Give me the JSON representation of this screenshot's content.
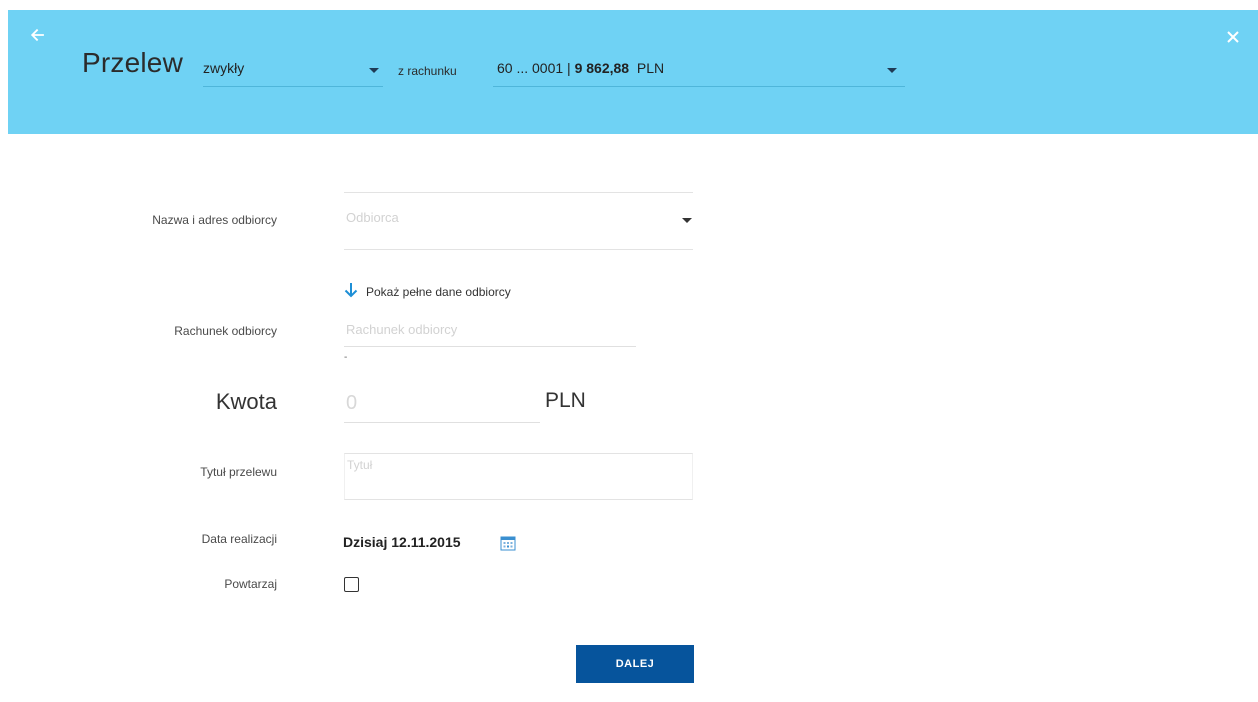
{
  "header": {
    "title": "Przelew",
    "transfer_type": "zwykły",
    "from_account_label": "z rachunku",
    "account_number": "60 ... 0001 | ",
    "balance": "9 862,88",
    "currency": "PLN",
    "back_icon": "arrow-left-icon",
    "close_icon": "close-icon",
    "background_color": "#6fd2f4"
  },
  "form": {
    "recipient_label": "Nazwa i adres odbiorcy",
    "recipient_placeholder": "Odbiorca",
    "show_more_label": "Pokaż pełne dane odbiorcy",
    "account_label": "Rachunek odbiorcy",
    "account_placeholder": "Rachunek odbiorcy",
    "account_hint": "-",
    "amount_label": "Kwota",
    "amount_placeholder": "0",
    "amount_currency": "PLN",
    "title_label": "Tytuł przelewu",
    "title_placeholder": "Tytuł",
    "date_label": "Data realizacji",
    "date_value": "Dzisiaj 12.11.2015",
    "repeat_label": "Powtarzaj",
    "repeat_checked": false,
    "submit_label": "DALEJ",
    "submit_color": "#06549c"
  }
}
